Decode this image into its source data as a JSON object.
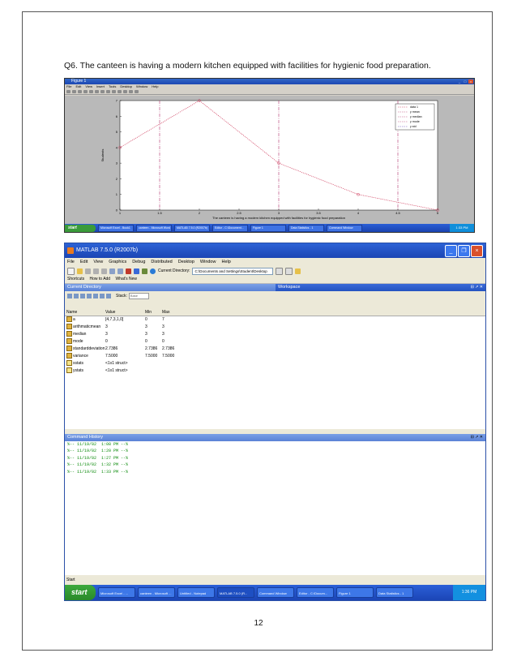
{
  "question": "Q6. The canteen is having a modern kitchen equipped with facilities for hygienic food preparation.",
  "page_number": "12",
  "figure_window": {
    "title": "Figure 1",
    "menu": [
      "File",
      "Edit",
      "View",
      "Insert",
      "Tools",
      "Desktop",
      "Window",
      "Help"
    ],
    "taskbar_start": "start",
    "taskbar_items": [
      "Microsoft Excel - Book1",
      "canteen - Microsoft Word",
      "MATLAB 7.5.0 (R2007b)",
      "Editor - C:\\Document...",
      "Figure 1",
      "Data Statistics - 1",
      "Command Window"
    ],
    "clock": "1:33 PM"
  },
  "chart_data": {
    "type": "line",
    "title": "The canteen is having a modern kitchen equipped with facilities for hygienic food preparation",
    "xlabel": "",
    "ylabel": "Students",
    "x": [
      1,
      2,
      3,
      4,
      5
    ],
    "xticks": [
      "1",
      "1.5",
      "2",
      "2.5",
      "3",
      "3.5",
      "4",
      "4.5",
      "5"
    ],
    "yticks": [
      "0",
      "1",
      "2",
      "3",
      "4",
      "5",
      "6",
      "7"
    ],
    "xlim": [
      1,
      5
    ],
    "ylim": [
      0,
      7
    ],
    "series": [
      {
        "name": "data 1",
        "values": [
          4,
          7,
          3,
          1,
          0
        ],
        "color": "#d04060"
      }
    ],
    "stat_lines": [
      {
        "name": "y mean",
        "value": 3,
        "color": "#d04060"
      },
      {
        "name": "y median",
        "value": 3,
        "color": "#d04060"
      },
      {
        "name": "y mode",
        "value": 0,
        "color": "#d04060"
      },
      {
        "name": "y std",
        "value": 2.7386,
        "color": "#7050c0"
      }
    ],
    "legend": [
      "data 1",
      "y mean",
      "y median",
      "y mode",
      "y std"
    ],
    "legend_position": "top-right",
    "grid": false
  },
  "matlab": {
    "title": "MATLAB 7.5.0 (R2007b)",
    "menu": [
      "File",
      "Edit",
      "View",
      "Graphics",
      "Debug",
      "Distributed",
      "Desktop",
      "Window",
      "Help"
    ],
    "current_directory_label": "Current Directory:",
    "current_directory_value": "C:\\Documents and Settings\\Student\\Desktop",
    "shortcuts": [
      "Shortcuts",
      "How to Add",
      "What's New"
    ],
    "current_directory_tab": "Current Directory",
    "workspace_tab": "Workspace",
    "stack_label": "Stack:",
    "stack_value": "Base",
    "columns": {
      "name": "Name",
      "value": "Value",
      "min": "Min",
      "max": "Max"
    },
    "variables": [
      {
        "name": "a",
        "value": "[4,7,3,1,0]",
        "min": "0",
        "max": "7",
        "kind": "numeric"
      },
      {
        "name": "arithmaticmean",
        "value": "3",
        "min": "3",
        "max": "3",
        "kind": "numeric"
      },
      {
        "name": "median",
        "value": "3",
        "min": "3",
        "max": "3",
        "kind": "numeric"
      },
      {
        "name": "mode",
        "value": "0",
        "min": "0",
        "max": "0",
        "kind": "numeric"
      },
      {
        "name": "standarddeviation",
        "value": "2.7386",
        "min": "2.7386",
        "max": "2.7386",
        "kind": "numeric"
      },
      {
        "name": "variance",
        "value": "7.5000",
        "min": "7.5000",
        "max": "7.5000",
        "kind": "numeric"
      },
      {
        "name": "xstats",
        "value": "<1x1 struct>",
        "min": "",
        "max": "",
        "kind": "struct"
      },
      {
        "name": "ystats",
        "value": "<1x1 struct>",
        "min": "",
        "max": "",
        "kind": "struct"
      }
    ],
    "command_history_title": "Command History",
    "history": [
      "%-- 11/19/02  1:08 PM --%",
      "%-- 11/19/02  1:20 PM --%",
      "%-- 11/19/02  1:27 PM --%",
      "%-- 11/19/02  1:32 PM --%",
      "%-- 11/19/02  1:33 PM --%"
    ],
    "start_tab": "Start"
  },
  "taskbar": {
    "start": "start",
    "items": [
      "Microsoft Excel - ...",
      "canteen - Microsoft ...",
      "Untitled - Notepad",
      "MATLAB 7.5.0 (R...",
      "Command Window",
      "Editor - C:\\Docum...",
      "Figure 1",
      "Data Statistics - 1"
    ],
    "clock": "1:36 PM"
  }
}
